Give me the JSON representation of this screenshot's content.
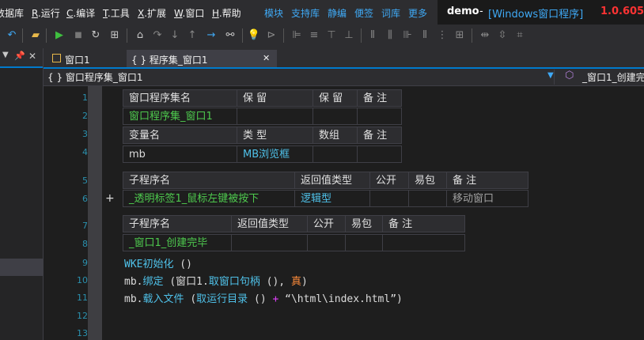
{
  "menu": {
    "items": [
      {
        "label": "数据库"
      },
      {
        "key": "R",
        "label": ".运行"
      },
      {
        "key": "C",
        "label": ".编译"
      },
      {
        "key": "T",
        "label": ".工具"
      },
      {
        "key": "X",
        "label": ".扩展"
      },
      {
        "key": "W",
        "label": ".窗口"
      },
      {
        "key": "H",
        "label": ".帮助"
      }
    ],
    "quick_links": [
      "模块",
      "支持库",
      "静编",
      "便签",
      "词库",
      "更多"
    ]
  },
  "title": {
    "project": "demo",
    "separator": "-",
    "window": "[Windows窗口程序]",
    "version": "1.0.605 ..."
  },
  "left_panel": {
    "pin_icon": "📌",
    "close_icon": "✕"
  },
  "tabs": [
    {
      "label": "窗口1",
      "active": false
    },
    {
      "label": "{ } 程序集_窗口1",
      "active": true
    }
  ],
  "tab_close": "✕",
  "navbar": {
    "left": "{ } 窗口程序集_窗口1",
    "right": "_窗口1_创建完"
  },
  "line_numbers": [
    "1",
    "2",
    "3",
    "4",
    "5",
    "6",
    "7",
    "8",
    "9",
    "10",
    "11",
    "12",
    "13"
  ],
  "gutter_marks": {
    "line6": "+"
  },
  "table1": {
    "headers1": [
      "窗口程序集名",
      "保 留",
      "保 留",
      "备 注"
    ],
    "row1": [
      "窗口程序集_窗口1",
      "",
      "",
      ""
    ],
    "headers2": [
      "变量名",
      "类 型",
      "数组",
      "备 注"
    ],
    "row2": [
      "mb",
      "MB浏览框",
      "",
      ""
    ]
  },
  "table2": {
    "headers": [
      "子程序名",
      "返回值类型",
      "公开",
      "易包",
      "备 注"
    ],
    "row": [
      "_透明标签1_鼠标左键被按下",
      "逻辑型",
      "",
      "",
      "移动窗口"
    ]
  },
  "table3": {
    "headers": [
      "子程序名",
      "返回值类型",
      "公开",
      "易包",
      "备 注"
    ],
    "row": [
      "_窗口1_创建完毕",
      "",
      "",
      "",
      ""
    ]
  },
  "code": {
    "line9": {
      "fn": "WKE初始化",
      "args": " ()"
    },
    "line10": {
      "obj": "mb.",
      "fn": "绑定",
      "open": " (窗口1.",
      "fn2": "取窗口句柄",
      "mid": " (), ",
      "bool": "真",
      "close": ")"
    },
    "line11": {
      "obj": "mb.",
      "fn": "载入文件",
      "open": " (",
      "fn2": "取运行目录",
      "mid": " () ",
      "plus": "+",
      "str": " “\\html\\index.html”)"
    }
  },
  "colors": {
    "accent": "#007acc",
    "link": "#3fa9f5",
    "green": "#4ec94e",
    "cyan": "#4fc1e9",
    "orange": "#ff8c3a",
    "version_red": "#ff3333"
  }
}
